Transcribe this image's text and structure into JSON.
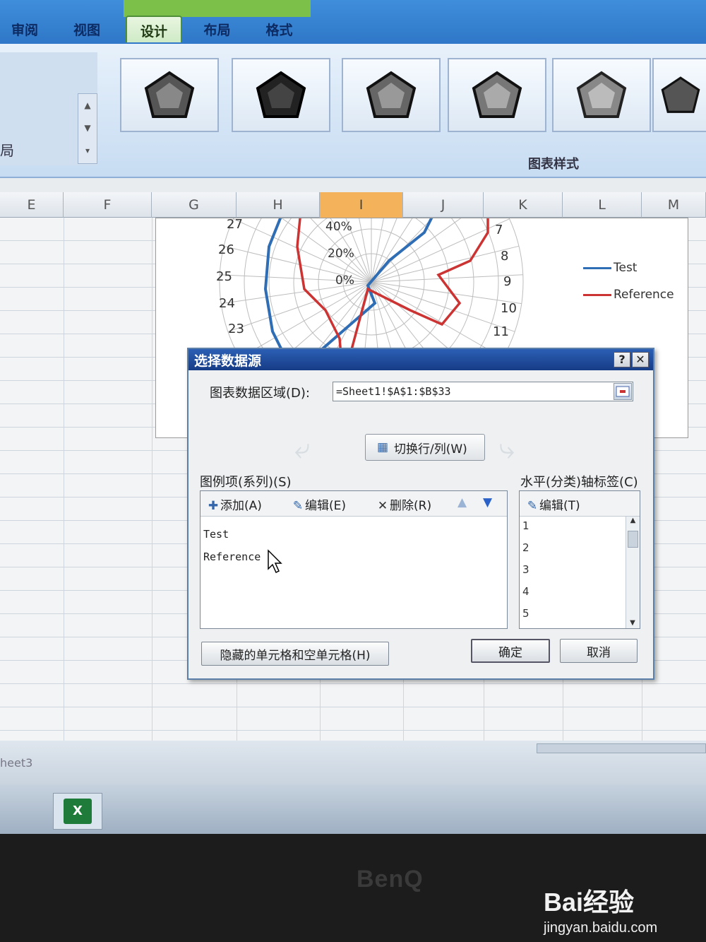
{
  "ribbon": {
    "tabs": [
      "审阅",
      "视图",
      "设计",
      "布局",
      "格式"
    ],
    "active_tab": "设计",
    "layout_group_label": "局",
    "styles_group_label": "图表样式"
  },
  "columns": [
    "E",
    "F",
    "G",
    "H",
    "I",
    "J",
    "K",
    "L",
    "M"
  ],
  "active_column": "I",
  "chart_data": {
    "type": "radar",
    "radial_ticks": [
      "40%",
      "20%",
      "0%"
    ],
    "categories_visible": [
      "27",
      "26",
      "25",
      "24",
      "23",
      "7",
      "8",
      "9",
      "10",
      "11"
    ],
    "series": [
      {
        "name": "Test",
        "color": "#2f6db5"
      },
      {
        "name": "Reference",
        "color": "#cc3333"
      }
    ]
  },
  "dialog": {
    "title": "选择数据源",
    "help_button": "?",
    "close_button": "✕",
    "range_label": "图表数据区域(D):",
    "range_value": "=Sheet1!$A$1:$B$33",
    "switch_label": "切换行/列(W)",
    "series_panel": {
      "label": "图例项(系列)(S)",
      "add": "添加(A)",
      "edit": "编辑(E)",
      "delete": "删除(R)",
      "items": [
        "Test",
        "Reference"
      ]
    },
    "category_panel": {
      "label": "水平(分类)轴标签(C)",
      "edit": "编辑(T)",
      "items": [
        "1",
        "2",
        "3",
        "4",
        "5"
      ]
    },
    "hidden_cells_button": "隐藏的单元格和空单元格(H)",
    "ok_button": "确定",
    "cancel_button": "取消"
  },
  "sheet_tab": "heet3",
  "monitor_brand": "BenQ",
  "watermark": {
    "logo": "Bai经验",
    "url": "jingyan.baidu.com"
  }
}
